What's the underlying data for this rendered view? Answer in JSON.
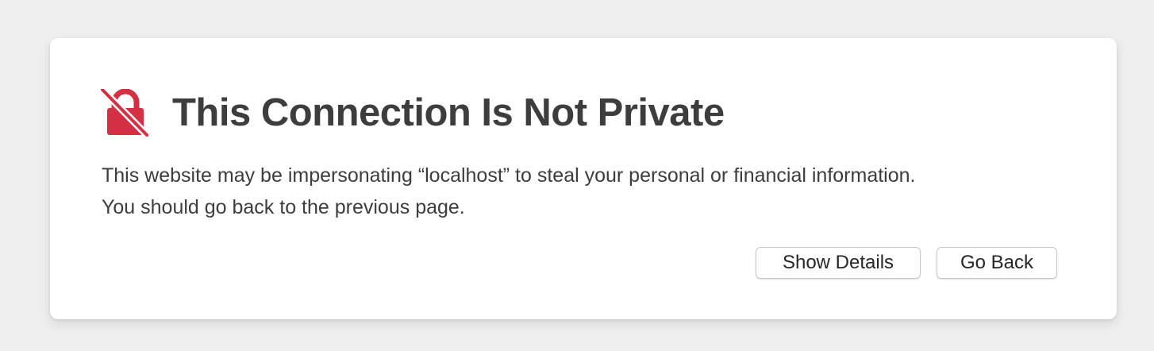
{
  "warning": {
    "icon": "broken-lock-icon",
    "icon_color": "#d33143",
    "title": "This Connection Is Not Private",
    "message_line1": "This website may be impersonating “localhost” to steal your personal or financial information.",
    "message_line2": "You should go back to the previous page."
  },
  "actions": {
    "show_details_label": "Show Details",
    "go_back_label": "Go Back"
  }
}
